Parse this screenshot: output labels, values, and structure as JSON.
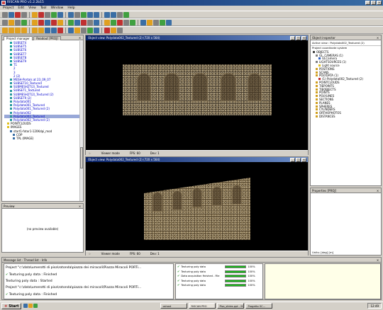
{
  "window": {
    "title": "RISCAN PRO v1.2.2b15"
  },
  "menu": [
    "Project",
    "Edit",
    "View",
    "Tool",
    "Window",
    "Help"
  ],
  "project_manager": {
    "tabs": [
      "Project manager",
      "Readout [PROJ]"
    ],
    "items": [
      {
        "label": "SUBSET4",
        "indent": 2,
        "icon": "scan",
        "style": "link"
      },
      {
        "label": "SUBSET5",
        "indent": 2,
        "icon": "scan",
        "style": "link"
      },
      {
        "label": "SUBSET6",
        "indent": 2,
        "icon": "scan",
        "style": "link"
      },
      {
        "label": "SUBSET7",
        "indent": 2,
        "icon": "scan",
        "style": "link"
      },
      {
        "label": "SUBSET8",
        "indent": 2,
        "icon": "scan",
        "style": "link"
      },
      {
        "label": "SUBSET9",
        "indent": 2,
        "icon": "scan",
        "style": "link"
      },
      {
        "label": "T1",
        "indent": 2,
        "icon": "scan",
        "style": "link"
      },
      {
        "label": "2",
        "indent": 2,
        "icon": "none",
        "style": "link"
      },
      {
        "label": "3",
        "indent": 2,
        "icon": "none",
        "style": "link"
      },
      {
        "label": "2 (2)",
        "indent": 2,
        "icon": "none",
        "style": "link"
      },
      {
        "label": "MESH-Portals at 23_09_07",
        "indent": 2,
        "icon": "mesh",
        "style": "link"
      },
      {
        "label": "SUBSET10_Textured",
        "indent": 2,
        "icon": "mesh",
        "style": "link"
      },
      {
        "label": "SUBMESH2T(2)_Textured",
        "indent": 2,
        "icon": "mesh",
        "style": "link"
      },
      {
        "label": "SUBSET1_Textured",
        "indent": 2,
        "icon": "mesh",
        "style": "link"
      },
      {
        "label": "SUBMESH2T(2)_Textured (2)",
        "indent": 2,
        "icon": "mesh",
        "style": "link"
      },
      {
        "label": "SUBSET9 (2)",
        "indent": 2,
        "icon": "mesh",
        "style": "link"
      },
      {
        "label": "Polydata001",
        "indent": 2,
        "icon": "mesh",
        "style": "link"
      },
      {
        "label": "Polydata001_Textured",
        "indent": 2,
        "icon": "mesh",
        "style": "link"
      },
      {
        "label": "Polydata001_Textured (2)",
        "indent": 2,
        "icon": "mesh",
        "style": "link"
      },
      {
        "label": "Polydata002",
        "indent": 2,
        "icon": "mesh",
        "style": "link"
      },
      {
        "label": "Polydata002_Textured",
        "indent": 2,
        "icon": "mesh",
        "style": "selected"
      },
      {
        "label": "Polydata002_Textured (2)",
        "indent": 2,
        "icon": "mesh",
        "style": "link"
      },
      {
        "label": "POINTCLOUDS",
        "indent": 1,
        "icon": "folder",
        "style": "plain"
      },
      {
        "label": "IMAGES",
        "indent": 1,
        "icon": "folder",
        "style": "plain"
      },
      {
        "label": "start1-fotor1-120Kdpi_mod",
        "indent": 2,
        "icon": "image",
        "style": "plain"
      },
      {
        "label": "COP",
        "indent": 3,
        "icon": "image",
        "style": "plain"
      },
      {
        "label": "TPL (IMAGE)",
        "indent": 3,
        "icon": "image",
        "style": "plain"
      }
    ]
  },
  "preview": {
    "title": "Preview",
    "empty_text": "(no preview available)"
  },
  "viewport_top": {
    "title": "Object view: Polydata002_Textured (2) (720 x 564)",
    "mode": "Viewer mode",
    "fps": "FPS: 60",
    "dev": "Dev: 1"
  },
  "viewport_bottom": {
    "title": "Object view: Polydata002_Textured (2) (720 x 564)",
    "mode": "Viewer mode",
    "fps": "FPS: 60",
    "dev": "Dev: 1"
  },
  "object_inspector": {
    "title": "Object inspector",
    "active_view": "Active view : Polydata002_Textured (2)",
    "cs_label": "Project coordinate system",
    "items": [
      {
        "label": "OBJECTS",
        "indent": 0,
        "color": "#404040"
      },
      {
        "label": "GL_CAMERAS (1)",
        "indent": 1,
        "color": "#808080"
      },
      {
        "label": "GLCamera",
        "indent": 2,
        "color": "#3060c0"
      },
      {
        "label": "LIGHTSOURCES (1)",
        "indent": 1,
        "color": "#808080"
      },
      {
        "label": "Light source",
        "indent": 2,
        "color": "#e0c020"
      },
      {
        "label": "POSITIONS",
        "indent": 1,
        "color": "#d0a020"
      },
      {
        "label": "SCANS",
        "indent": 1,
        "color": "#d0a020"
      },
      {
        "label": "POLYDATA (1)",
        "indent": 1,
        "color": "#d0a020"
      },
      {
        "label": "(1) Polydata002_Textured (2)",
        "indent": 2,
        "color": "#c03030"
      },
      {
        "label": "POINTCLOUDS",
        "indent": 1,
        "color": "#d0a020"
      },
      {
        "label": "TIEPOINTS",
        "indent": 1,
        "color": "#d0a020"
      },
      {
        "label": "TIEOBJECTS",
        "indent": 1,
        "color": "#d0a020"
      },
      {
        "label": "POINTS",
        "indent": 1,
        "color": "#d0a020"
      },
      {
        "label": "POLYLINES",
        "indent": 1,
        "color": "#d0a020"
      },
      {
        "label": "SECTIONS",
        "indent": 1,
        "color": "#d0a020"
      },
      {
        "label": "PLANES",
        "indent": 1,
        "color": "#d0a020"
      },
      {
        "label": "SPHERES",
        "indent": 1,
        "color": "#d0a020"
      },
      {
        "label": "CYLINDERS",
        "indent": 1,
        "color": "#d0a020"
      },
      {
        "label": "ORTHOPHOTOS",
        "indent": 1,
        "color": "#d0a020"
      },
      {
        "label": "DISTANCES",
        "indent": 1,
        "color": "#d0a020"
      }
    ]
  },
  "properties": {
    "title": "Properties [PROJ]",
    "units": "Units: [deg] [m]"
  },
  "message_list": {
    "title": "Message list - Thread list - Info",
    "lines": [
      {
        "text": "Project \"c:\\data\\umerotti di pisa\\rotonda\\piazza dei miracoli\\Piazza Miracoli PORTi...",
        "status": "info"
      },
      {
        "text": "Texturing poly data : Finished",
        "status": "ok"
      },
      {
        "text": "Texturing poly data : Started",
        "status": "info"
      },
      {
        "text": "Project \"c:\\data\\umerotti di pisa\\rotonda\\piazza dei miracoli\\Piazza Miracoli PORTi...",
        "status": "info"
      },
      {
        "text": "Texturing poly data : Finished",
        "status": "ok"
      }
    ]
  },
  "threads": [
    {
      "label": "Texturing poly data",
      "progress": 1.0,
      "pct": "100%"
    },
    {
      "label": "Texturing poly data",
      "progress": 1.0,
      "pct": "100%"
    },
    {
      "label": "Data acquisition finished - File",
      "progress": 1.0,
      "pct": "100%"
    },
    {
      "label": "Texturing poly data",
      "progress": 1.0,
      "pct": "100%"
    },
    {
      "label": "Texturing poly data",
      "progress": 1.0,
      "pct": "100%"
    }
  ],
  "taskbar": {
    "start": "Start",
    "tasks": [
      "oshost",
      "RiSCAN PRO",
      "Pisa_slides.ppt - M...",
      "Progetto SC..."
    ],
    "clock": "12:49"
  }
}
